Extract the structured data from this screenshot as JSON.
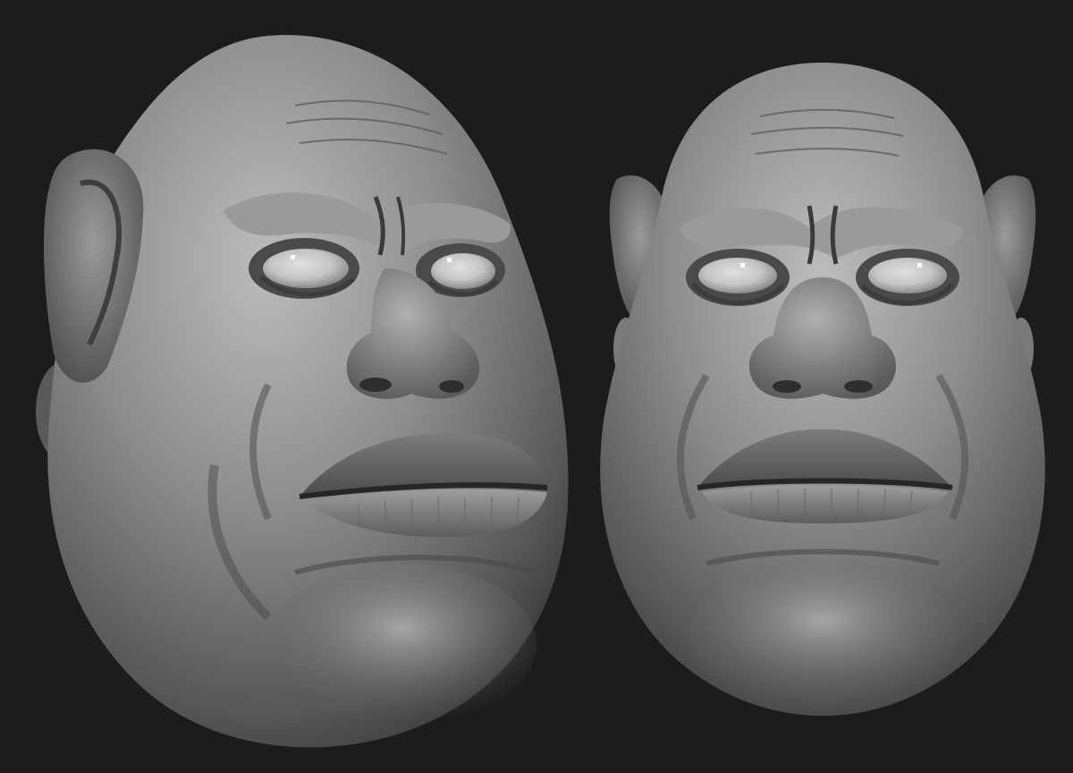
{
  "scene": {
    "background_color": "#1c1c1c",
    "subject": "two-views-sculpted-head",
    "views": [
      {
        "name": "three-quarter-view"
      },
      {
        "name": "front-view"
      }
    ],
    "palette": {
      "skin_light": "#b4b4b4",
      "skin_mid": "#8a8a8a",
      "skin_dark": "#3c3c3c",
      "eye_white": "#d2d2d2",
      "crease": "#262626"
    }
  }
}
